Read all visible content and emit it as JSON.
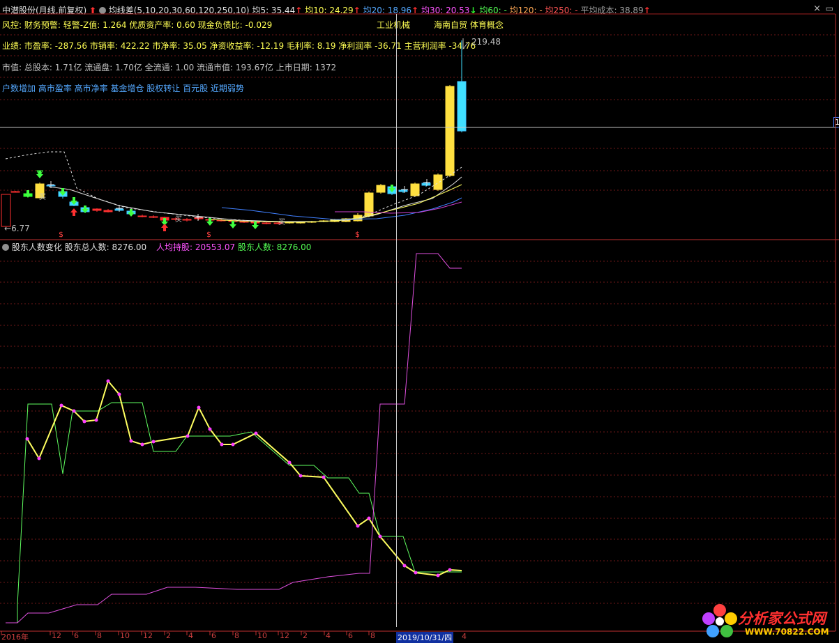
{
  "header": {
    "stock": "中潜股份",
    "period": "(月线,前复权)",
    "indicator": "均线差(5,10,20,30,60,120,250,10)",
    "ma5": "均5: 35.44",
    "ma10": "均10: 24.29",
    "ma20": "均20: 18.96",
    "ma30": "均30: 20.53",
    "ma60": "均60: -",
    "ma120": "均120: -",
    "ma250": "均250: -",
    "avg_cost": "平均成本: 38.89"
  },
  "info": {
    "line1": "风控: 财务预警: 轻警-Z值: 1.264 优质资产率: 0.60 现金负债比: -0.029",
    "industry": "工业机械",
    "concept": "海南自贸 体育概念",
    "line2": "业绩: 市盈率: -287.56 市销率: 422.22 市净率: 35.05 净资收益率: -12.19 毛利率: 8.19 净利润率 -36.71 主营利润率 -34.76",
    "line3": "市值: 总股本: 1.71亿 流通盘: 1.70亿 全流通: 1.00 流通市值: 193.67亿 上市日期: 1372",
    "line4": "户数增加 高市盈率 高市净率 基金增仓 股权转让 百元股 近期弱势"
  },
  "price_labels": {
    "high": "219.48",
    "low": "6.77",
    "right_tag": "1"
  },
  "marks": {
    "dollar": "$",
    "buy": "买"
  },
  "sub": {
    "title": "股东人数变化",
    "total": "股东总人数: 8276.00",
    "per_holder": "人均持股: 20553.07",
    "holders": "股东人数: 8276.00"
  },
  "xaxis": {
    "labels": [
      "2016年",
      "12",
      "6",
      "8",
      "10",
      "12",
      "2",
      "4",
      "6",
      "8",
      "10",
      "12",
      "2",
      "4",
      "6",
      "8"
    ],
    "cursor_date": "2019/10/31/四",
    "tail_label": "4"
  },
  "logo": {
    "name": "分析家公式网",
    "url": "WWW.70822.COM"
  },
  "colors": {
    "up": "#ff3030",
    "down": "#30ff30",
    "candle_yellow": "#ffe040",
    "candle_cyan": "#40e0ff",
    "magenta": "#e050e0",
    "green_line": "#60ff60",
    "yellow_line": "#ffff60"
  }
}
